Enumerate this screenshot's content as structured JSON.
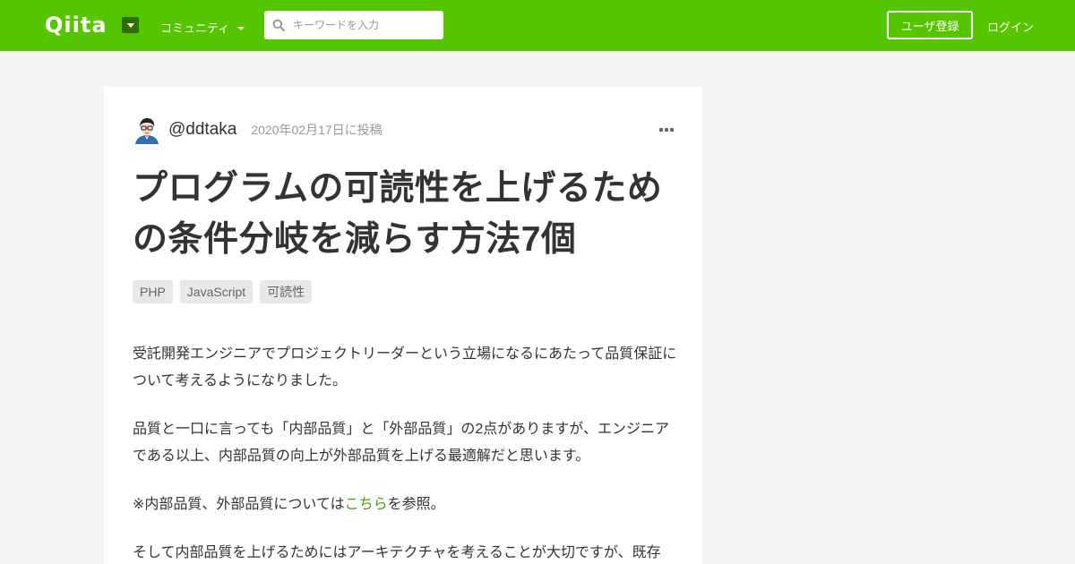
{
  "header": {
    "logo": "Qiita",
    "community_label": "コミュニティ",
    "search_placeholder": "キーワードを入力",
    "signup_label": "ユーザ登録",
    "login_label": "ログイン"
  },
  "article": {
    "author": "@ddtaka",
    "date": "2020年02月17日に投稿",
    "title": "プログラムの可読性を上げるための条件分岐を減らす方法7個",
    "tags": [
      "PHP",
      "JavaScript",
      "可読性"
    ],
    "paragraphs": {
      "p1": "受託開発エンジニアでプロジェクトリーダーという立場になるにあたって品質保証について考えるようになりました。",
      "p2": "品質と一口に言っても「内部品質」と「外部品質」の2点がありますが、エンジニアである以上、内部品質の向上が外部品質を上げる最適解だと思います。",
      "p3_before": "※内部品質、外部品質については",
      "p3_link": "こちら",
      "p3_after": "を参照。",
      "p4": "そして内部品質を上げるためにはアーキテクチャを考えることが大切ですが、既存"
    }
  },
  "colors": {
    "brand": "#55c500",
    "link": "#4ba100",
    "background": "#f5f5f5"
  }
}
